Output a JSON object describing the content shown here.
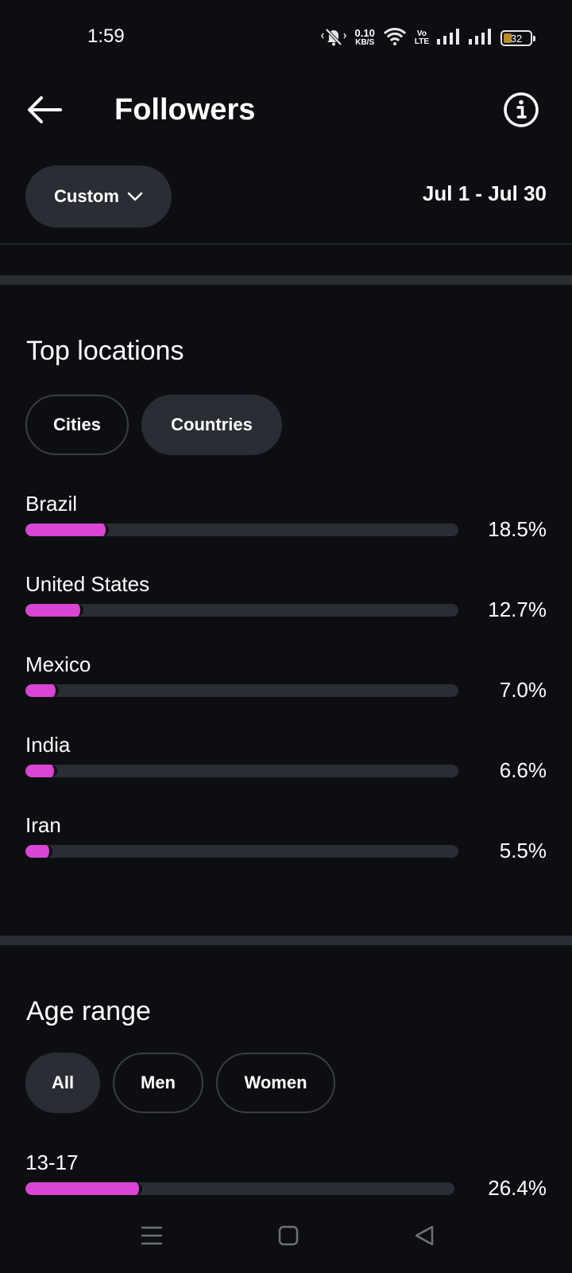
{
  "status_bar": {
    "time": "1:59",
    "net_speed_value": "0.10",
    "net_speed_unit": "KB/S",
    "volte_top": "Vo",
    "volte_bottom": "LTE",
    "battery_level": "32",
    "icons": [
      "mute-icon",
      "wifi-icon",
      "signal-icon",
      "signal-icon",
      "battery-icon"
    ]
  },
  "header": {
    "title": "Followers",
    "back_icon": "back-arrow-icon",
    "info_icon": "info-icon"
  },
  "filter": {
    "period_label": "Custom",
    "date_range": "Jul 1 - Jul 30"
  },
  "top_locations": {
    "title": "Top locations",
    "tabs": [
      {
        "label": "Cities",
        "selected": false
      },
      {
        "label": "Countries",
        "selected": true
      }
    ],
    "items": [
      {
        "label": "Brazil",
        "value": "18.5%",
        "fraction": 0.185
      },
      {
        "label": "United States",
        "value": "12.7%",
        "fraction": 0.127
      },
      {
        "label": "Mexico",
        "value": "7.0%",
        "fraction": 0.07
      },
      {
        "label": "India",
        "value": "6.6%",
        "fraction": 0.066
      },
      {
        "label": "Iran",
        "value": "5.5%",
        "fraction": 0.055
      }
    ]
  },
  "age_range": {
    "title": "Age range",
    "tabs": [
      {
        "label": "All",
        "selected": true
      },
      {
        "label": "Men",
        "selected": false
      },
      {
        "label": "Women",
        "selected": false
      }
    ],
    "items": [
      {
        "label": "13-17",
        "value": "26.4%",
        "fraction": 0.264
      }
    ]
  },
  "colors": {
    "background": "#0c0e12",
    "bar_fill": "#d945d4",
    "bar_track": "#2a2d33"
  },
  "nav_bar": {
    "icons": [
      "menu-icon",
      "home-icon",
      "back-triangle-icon"
    ]
  }
}
